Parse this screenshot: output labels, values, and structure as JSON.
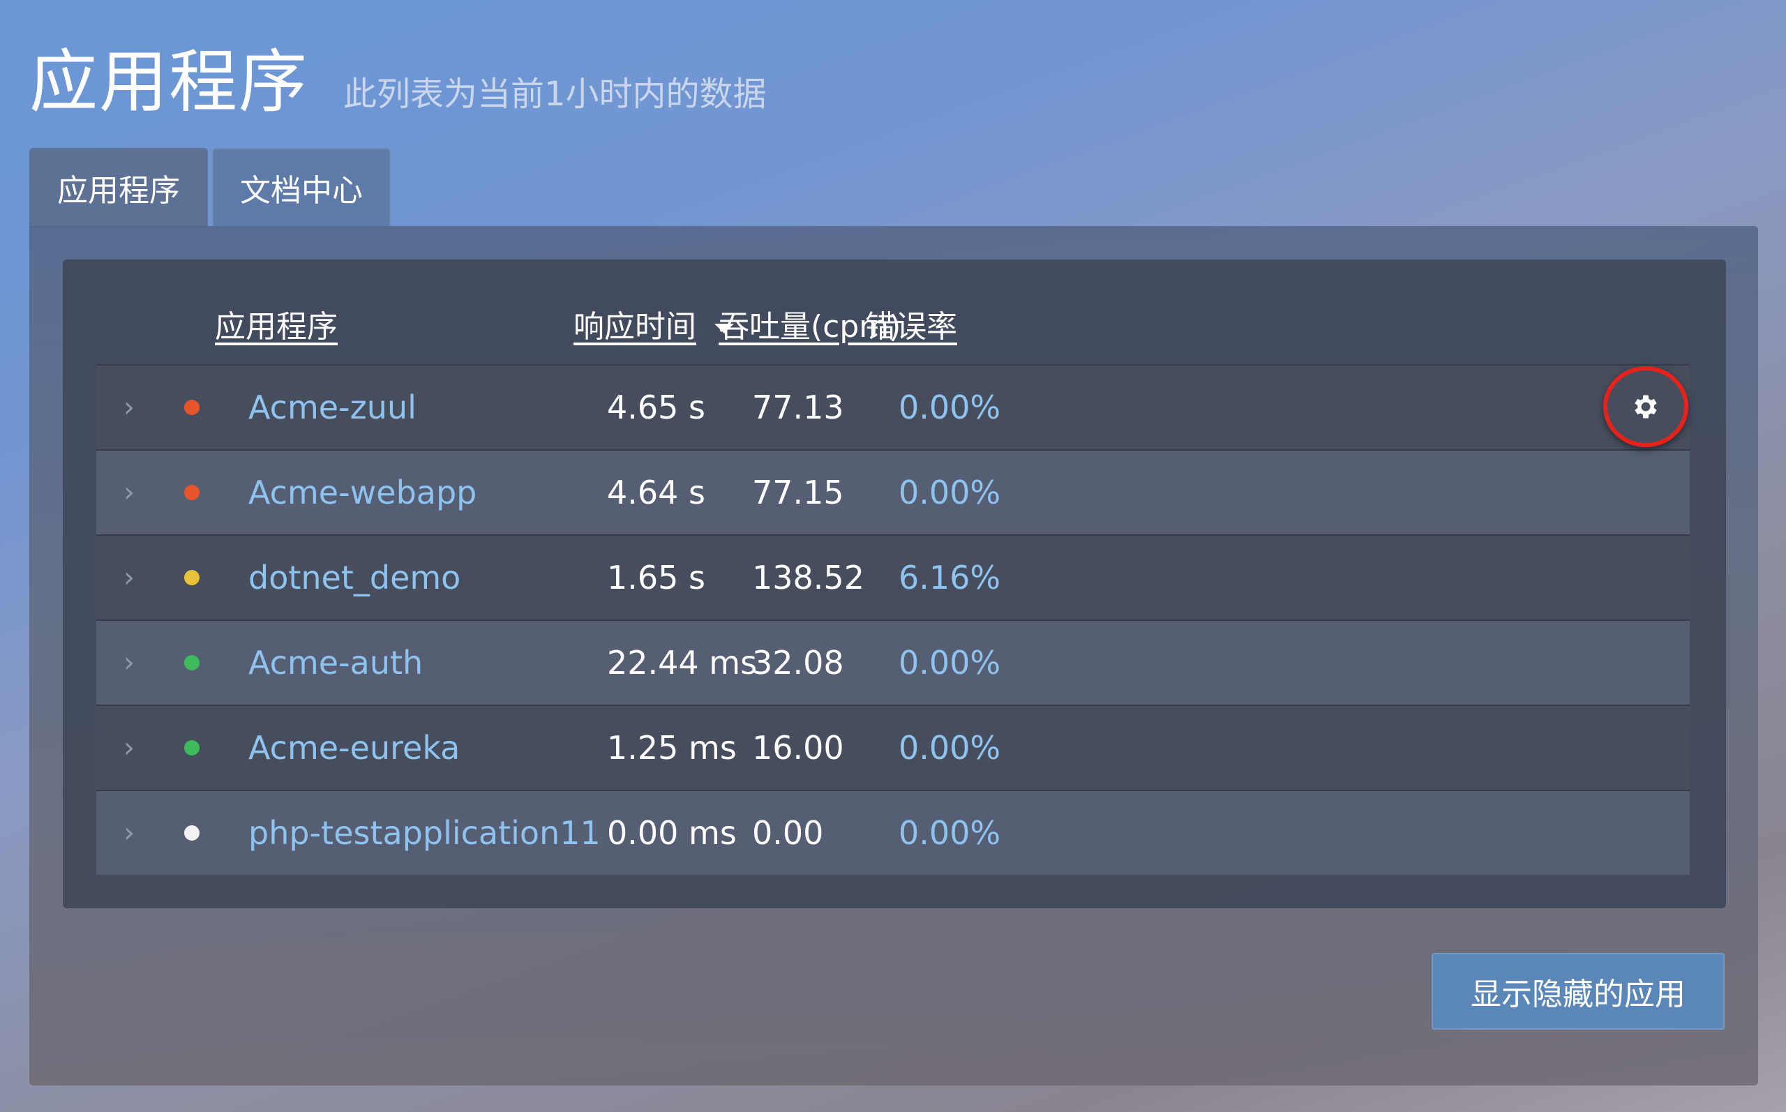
{
  "header": {
    "title": "应用程序",
    "subtitle": "此列表为当前1小时内的数据"
  },
  "tabs": [
    {
      "label": "应用程序",
      "active": true
    },
    {
      "label": "文档中心",
      "active": false
    }
  ],
  "table": {
    "columns": {
      "name": "应用程序",
      "response_time": "响应时间",
      "throughput": "吞吐量(cpm)",
      "error_rate": "错误率"
    },
    "sort": {
      "column": "response_time",
      "direction": "descending"
    },
    "rows": [
      {
        "name": "Acme-zuul",
        "status_color": "#e8552b",
        "response_time": "4.65 s",
        "throughput": "77.13",
        "error_rate": "0.00%"
      },
      {
        "name": "Acme-webapp",
        "status_color": "#e8552b",
        "response_time": "4.64 s",
        "throughput": "77.15",
        "error_rate": "0.00%"
      },
      {
        "name": "dotnet_demo",
        "status_color": "#e8c13a",
        "response_time": "1.65 s",
        "throughput": "138.52",
        "error_rate": "6.16%"
      },
      {
        "name": "Acme-auth",
        "status_color": "#3dbb5c",
        "response_time": "22.44 ms",
        "throughput": "32.08",
        "error_rate": "0.00%"
      },
      {
        "name": "Acme-eureka",
        "status_color": "#3dbb5c",
        "response_time": "1.25 ms",
        "throughput": "16.00",
        "error_rate": "0.00%"
      },
      {
        "name": "php-testapplication11",
        "status_color": "#f2f2f2",
        "response_time": "0.00 ms",
        "throughput": "0.00",
        "error_rate": "0.00%"
      }
    ],
    "row_icons": {
      "expand": "chevron-right-icon",
      "settings": "gear-icon"
    }
  },
  "buttons": {
    "show_hidden": "显示隐藏的应用"
  },
  "colors": {
    "link": "#8ec3f0",
    "highlight_ring": "#e8211a",
    "button": "#5a86b8"
  }
}
